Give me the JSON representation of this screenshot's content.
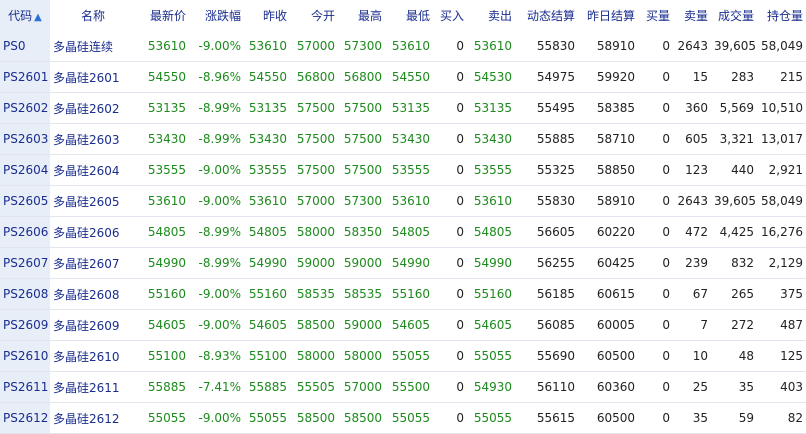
{
  "colors": {
    "header_text": "#1a2d8f",
    "down": "#1d8a1d",
    "neutral": "#222222",
    "code_bg": "#e7eef8"
  },
  "sort_icon": "arrow-up-icon",
  "columns": {
    "code": "代码",
    "name": "名称",
    "last": "最新价",
    "change_pct": "涨跌幅",
    "prev_close": "昨收",
    "open": "今开",
    "high": "最高",
    "low": "最低",
    "bid": "买入",
    "ask": "卖出",
    "dyn_settle": "动态结算",
    "prev_settle": "昨日结算",
    "bid_vol": "买量",
    "ask_vol": "卖量",
    "volume": "成交量",
    "open_interest": "持仓量"
  },
  "rows": [
    {
      "code": "PS0",
      "name": "多晶硅连续",
      "last": "53610",
      "change_pct": "-9.00%",
      "prev_close": "53610",
      "open": "57000",
      "high": "57300",
      "low": "53610",
      "bid": "0",
      "ask": "53610",
      "dyn_settle": "55830",
      "prev_settle": "58910",
      "bid_vol": "0",
      "ask_vol": "2643",
      "volume": "39,605",
      "open_interest": "58,049"
    },
    {
      "code": "PS2601",
      "name": "多晶硅2601",
      "last": "54550",
      "change_pct": "-8.96%",
      "prev_close": "54550",
      "open": "56800",
      "high": "56800",
      "low": "54550",
      "bid": "0",
      "ask": "54530",
      "dyn_settle": "54975",
      "prev_settle": "59920",
      "bid_vol": "0",
      "ask_vol": "15",
      "volume": "283",
      "open_interest": "215"
    },
    {
      "code": "PS2602",
      "name": "多晶硅2602",
      "last": "53135",
      "change_pct": "-8.99%",
      "prev_close": "53135",
      "open": "57500",
      "high": "57500",
      "low": "53135",
      "bid": "0",
      "ask": "53135",
      "dyn_settle": "55495",
      "prev_settle": "58385",
      "bid_vol": "0",
      "ask_vol": "360",
      "volume": "5,569",
      "open_interest": "10,510"
    },
    {
      "code": "PS2603",
      "name": "多晶硅2603",
      "last": "53430",
      "change_pct": "-8.99%",
      "prev_close": "53430",
      "open": "57500",
      "high": "57500",
      "low": "53430",
      "bid": "0",
      "ask": "53430",
      "dyn_settle": "55885",
      "prev_settle": "58710",
      "bid_vol": "0",
      "ask_vol": "605",
      "volume": "3,321",
      "open_interest": "13,017"
    },
    {
      "code": "PS2604",
      "name": "多晶硅2604",
      "last": "53555",
      "change_pct": "-9.00%",
      "prev_close": "53555",
      "open": "57500",
      "high": "57500",
      "low": "53555",
      "bid": "0",
      "ask": "53555",
      "dyn_settle": "55325",
      "prev_settle": "58850",
      "bid_vol": "0",
      "ask_vol": "123",
      "volume": "440",
      "open_interest": "2,921"
    },
    {
      "code": "PS2605",
      "name": "多晶硅2605",
      "last": "53610",
      "change_pct": "-9.00%",
      "prev_close": "53610",
      "open": "57000",
      "high": "57300",
      "low": "53610",
      "bid": "0",
      "ask": "53610",
      "dyn_settle": "55830",
      "prev_settle": "58910",
      "bid_vol": "0",
      "ask_vol": "2643",
      "volume": "39,605",
      "open_interest": "58,049"
    },
    {
      "code": "PS2606",
      "name": "多晶硅2606",
      "last": "54805",
      "change_pct": "-8.99%",
      "prev_close": "54805",
      "open": "58000",
      "high": "58350",
      "low": "54805",
      "bid": "0",
      "ask": "54805",
      "dyn_settle": "56605",
      "prev_settle": "60220",
      "bid_vol": "0",
      "ask_vol": "472",
      "volume": "4,425",
      "open_interest": "16,276"
    },
    {
      "code": "PS2607",
      "name": "多晶硅2607",
      "last": "54990",
      "change_pct": "-8.99%",
      "prev_close": "54990",
      "open": "59000",
      "high": "59000",
      "low": "54990",
      "bid": "0",
      "ask": "54990",
      "dyn_settle": "56255",
      "prev_settle": "60425",
      "bid_vol": "0",
      "ask_vol": "239",
      "volume": "832",
      "open_interest": "2,129"
    },
    {
      "code": "PS2608",
      "name": "多晶硅2608",
      "last": "55160",
      "change_pct": "-9.00%",
      "prev_close": "55160",
      "open": "58535",
      "high": "58535",
      "low": "55160",
      "bid": "0",
      "ask": "55160",
      "dyn_settle": "56185",
      "prev_settle": "60615",
      "bid_vol": "0",
      "ask_vol": "67",
      "volume": "265",
      "open_interest": "375"
    },
    {
      "code": "PS2609",
      "name": "多晶硅2609",
      "last": "54605",
      "change_pct": "-9.00%",
      "prev_close": "54605",
      "open": "58500",
      "high": "59000",
      "low": "54605",
      "bid": "0",
      "ask": "54605",
      "dyn_settle": "56085",
      "prev_settle": "60005",
      "bid_vol": "0",
      "ask_vol": "7",
      "volume": "272",
      "open_interest": "487"
    },
    {
      "code": "PS2610",
      "name": "多晶硅2610",
      "last": "55100",
      "change_pct": "-8.93%",
      "prev_close": "55100",
      "open": "58000",
      "high": "58000",
      "low": "55055",
      "bid": "0",
      "ask": "55055",
      "dyn_settle": "55690",
      "prev_settle": "60500",
      "bid_vol": "0",
      "ask_vol": "10",
      "volume": "48",
      "open_interest": "125"
    },
    {
      "code": "PS2611",
      "name": "多晶硅2611",
      "last": "55885",
      "change_pct": "-7.41%",
      "prev_close": "55885",
      "open": "55505",
      "high": "57000",
      "low": "55500",
      "bid": "0",
      "ask": "54930",
      "dyn_settle": "56110",
      "prev_settle": "60360",
      "bid_vol": "0",
      "ask_vol": "25",
      "volume": "35",
      "open_interest": "403"
    },
    {
      "code": "PS2612",
      "name": "多晶硅2612",
      "last": "55055",
      "change_pct": "-9.00%",
      "prev_close": "55055",
      "open": "58500",
      "high": "58500",
      "low": "55055",
      "bid": "0",
      "ask": "55055",
      "dyn_settle": "55615",
      "prev_settle": "60500",
      "bid_vol": "0",
      "ask_vol": "35",
      "volume": "59",
      "open_interest": "82"
    }
  ]
}
